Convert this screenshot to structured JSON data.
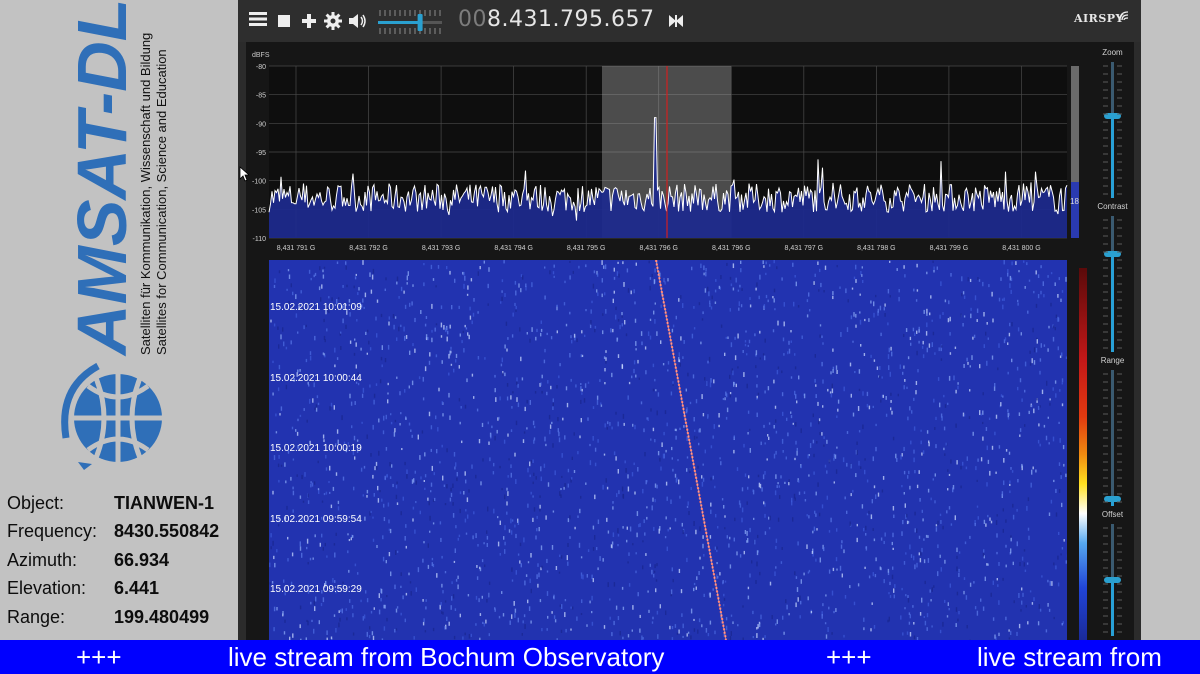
{
  "branding": {
    "logo_text": "AMSAT-DL",
    "tagline_de": "Satelliten für Kommunikation, Wissenschaft und Bildung",
    "tagline_en": "Satellites for Communication, Science and Education"
  },
  "info": [
    {
      "label": "Object:",
      "value": "TIANWEN-1"
    },
    {
      "label": "Frequency:",
      "value": "8430.550842"
    },
    {
      "label": "Azimuth:",
      "value": "66.934"
    },
    {
      "label": "Elevation:",
      "value": "6.441"
    },
    {
      "label": "Range:",
      "value": "199.480499"
    }
  ],
  "toolbar": {
    "menu_icon": "menu-icon",
    "stop_icon": "stop-icon",
    "add_icon": "plus-icon",
    "settings_icon": "gear-icon",
    "volume_icon": "speaker-icon",
    "frequency_lead": "00",
    "frequency_main": "8.431.795.657",
    "swap_icon": "bowtie-icon",
    "brand": "AIRSPY",
    "volume_level": 0.65
  },
  "spectrum": {
    "y_unit": "dBFS",
    "y_ticks": [
      "-80",
      "-85",
      "-90",
      "-95",
      "-100",
      "-105",
      "-110"
    ],
    "x_ticks": [
      "8,431 791 G",
      "8,431 792 G",
      "8,431 793 G",
      "8,431 794 G",
      "8,431 795 G",
      "8,431 796 G",
      "8,431 796 G",
      "8,431 797 G",
      "8,431 798 G",
      "8,431 799 G",
      "8,431 800 G"
    ],
    "side_value": "18",
    "noise_floor_db": -103,
    "peak_db": -89,
    "colors": {
      "trace": "#ffffff",
      "fill": "#1e2a8c",
      "marker": "#d02020",
      "filter": "#bfbfbf"
    }
  },
  "waterfall": {
    "timestamps": [
      "15.02.2021 10:01:09",
      "15.02.2021 10:00:44",
      "15.02.2021 10:00:19",
      "15.02.2021 09:59:54",
      "15.02.2021 09:59:29"
    ]
  },
  "sliders": [
    {
      "label": "Zoom",
      "level": 0.6
    },
    {
      "label": "Contrast",
      "level": 0.72
    },
    {
      "label": "Range",
      "level": 0.05
    },
    {
      "label": "Offset",
      "level": 0.5
    }
  ],
  "ticker": {
    "separator": "+++",
    "message": "live stream from Bochum Observatory",
    "message_cut": "live stream from"
  }
}
